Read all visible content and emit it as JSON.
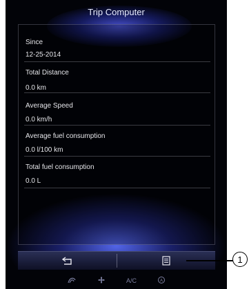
{
  "header": {
    "title": "Trip Computer"
  },
  "fields": [
    {
      "label": "Since",
      "value": "12-25-2014"
    },
    {
      "label": "Total Distance",
      "value": "0.0 km"
    },
    {
      "label": "Average Speed",
      "value": "0.0 km/h"
    },
    {
      "label": "Average fuel consumption",
      "value": "0.0 l/100 km"
    },
    {
      "label": "Total fuel consumption",
      "value": "0.0 L"
    }
  ],
  "toolbar": {
    "back_icon": "back-arrow-icon",
    "menu_icon": "list-menu-icon"
  },
  "bottom_bar": {
    "items": [
      "fan-icon",
      "fan-speed-icon",
      "A/C",
      "recirculation-icon"
    ],
    "ac_label": "A/C"
  },
  "callout": {
    "number": "1"
  },
  "colors": {
    "screen_bg": "#020308",
    "glow": "#5a6eff",
    "text": "#e6e6ea"
  }
}
